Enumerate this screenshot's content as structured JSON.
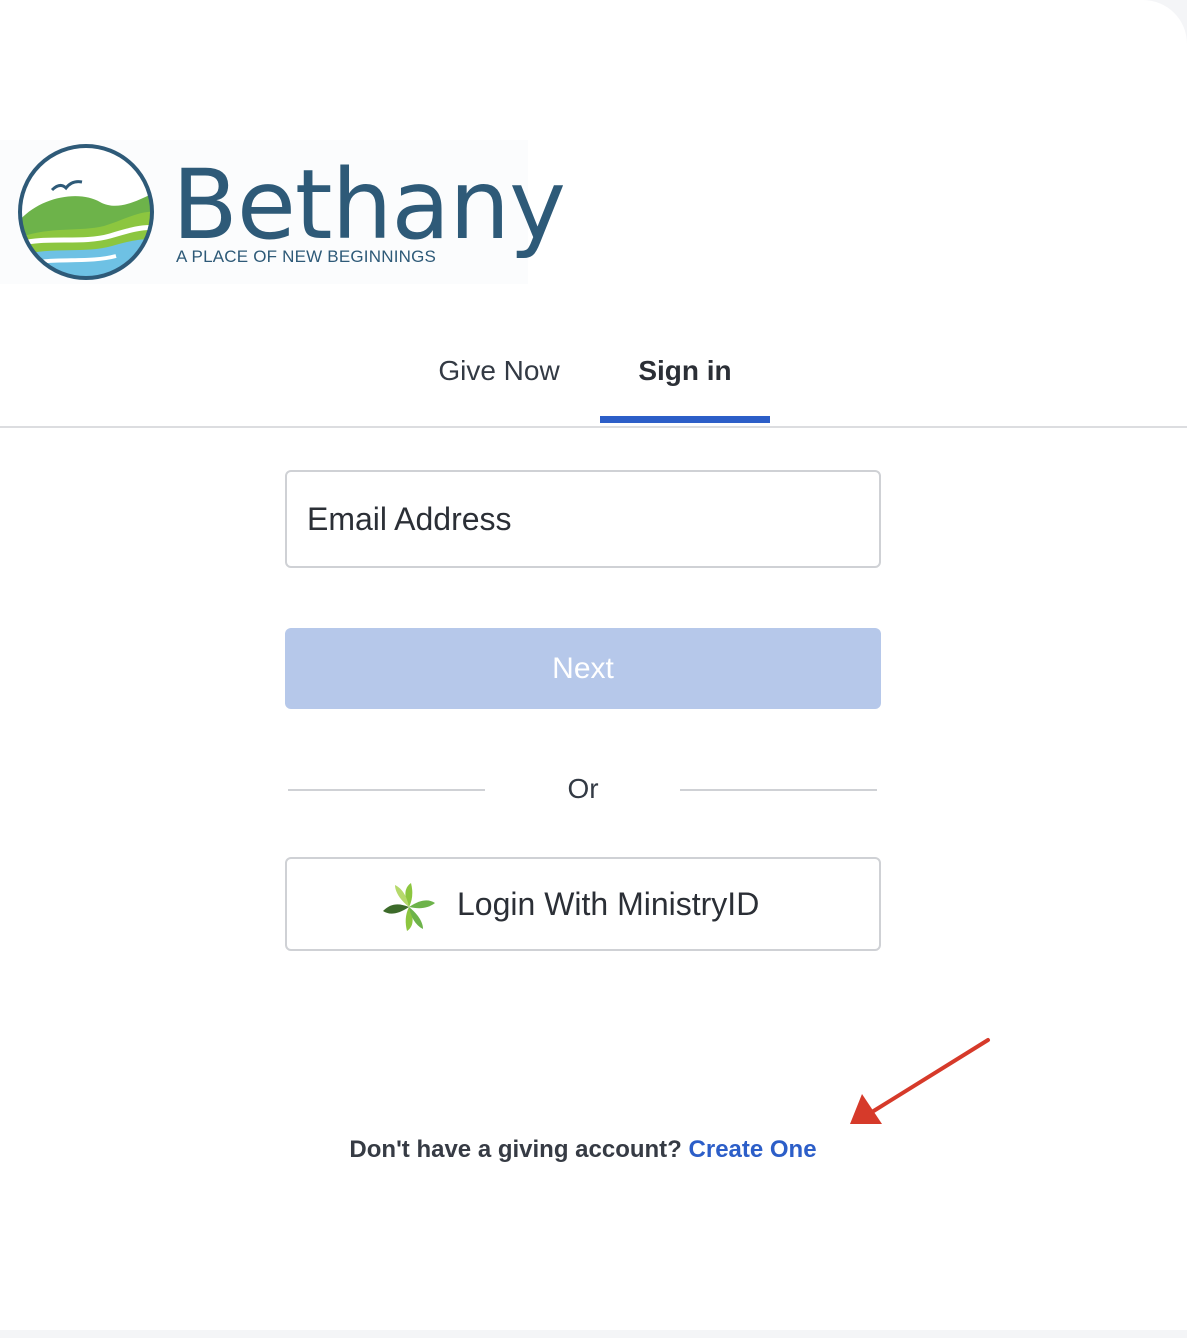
{
  "brand": {
    "name": "Bethany",
    "tagline": "A PLACE OF NEW BEGINNINGS",
    "color": "#2e5a78"
  },
  "tabs": {
    "give_now": "Give Now",
    "sign_in": "Sign in",
    "active": "Sign in",
    "accent": "#2c5ec8"
  },
  "form": {
    "email_placeholder": "Email Address",
    "email_value": "",
    "next_label": "Next",
    "divider_text": "Or",
    "ministry_label": "Login With MinistryID",
    "ministry_icon": "ministryid-leaf-icon"
  },
  "footer": {
    "prompt": "Don't have a giving account?",
    "link": "Create One"
  },
  "annotation": {
    "icon": "red-arrow-icon",
    "color": "#d63a2a"
  }
}
